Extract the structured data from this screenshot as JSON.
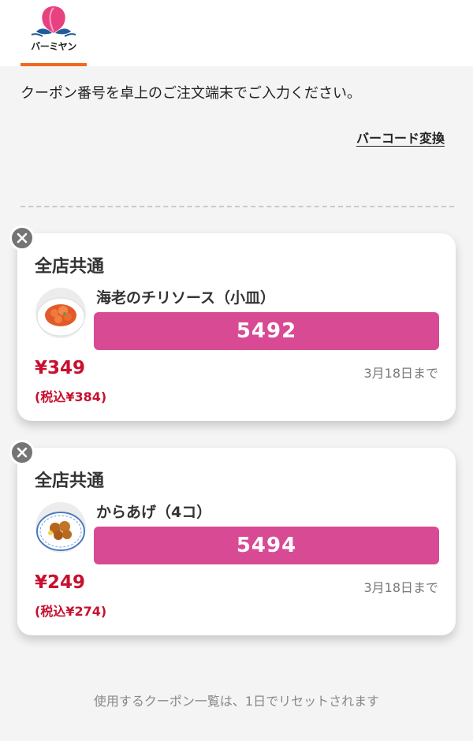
{
  "header": {
    "brand": "バーミヤン",
    "brand_colors": {
      "peach": "#e8417f",
      "leaf": "#1f5c99",
      "accent_underline": "#ee6a1f"
    }
  },
  "instruction": "クーポン番号を卓上のご注文端末でご入力ください。",
  "barcode_link": "バーコード変換",
  "coupons": [
    {
      "title": "全店共通",
      "item": "海老のチリソース（小皿）",
      "code": "5492",
      "price": "¥349",
      "tax_price": "(税込¥384)",
      "expiry": "3月18日まで",
      "image_icon": "shrimp-chili-dish-icon"
    },
    {
      "title": "全店共通",
      "item": "からあげ（4コ）",
      "code": "5494",
      "price": "¥249",
      "tax_price": "(税込¥274)",
      "expiry": "3月18日まで",
      "image_icon": "karaage-dish-icon"
    }
  ],
  "footer_note": "使用するクーポン一覧は、1日でリセットされます",
  "colors": {
    "code_bar": "#d94a94",
    "price": "#c8102e",
    "background": "#f4f4f4"
  }
}
